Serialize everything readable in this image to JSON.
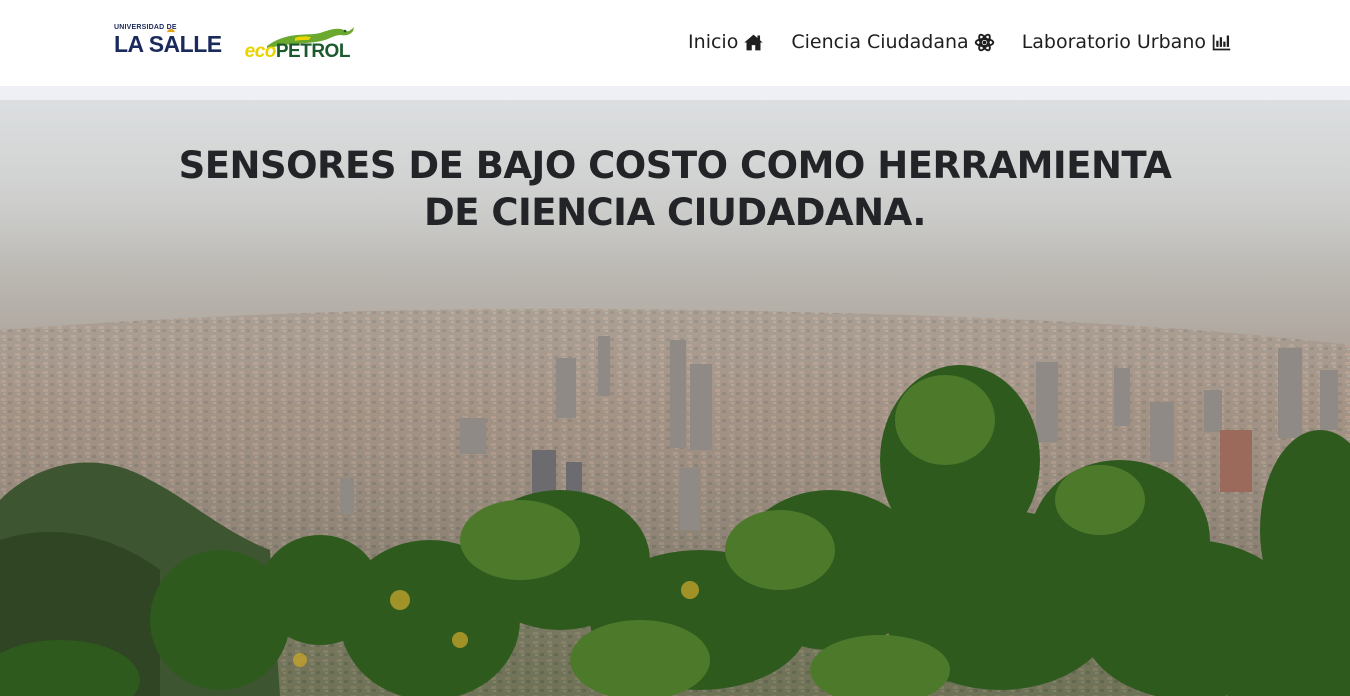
{
  "header": {
    "university_top": "UNIVERSIDAD DE",
    "university_name_part1": "LA S",
    "university_name_accent": "A",
    "university_name_part2": "LLE",
    "partner_eco": "eco",
    "partner_petrol": "PETROL",
    "nav": [
      {
        "label": "Inicio",
        "icon": "home-icon"
      },
      {
        "label": "Ciencia Ciudadana",
        "icon": "atom-icon"
      },
      {
        "label": "Laboratorio Urbano",
        "icon": "bar-chart-icon"
      }
    ]
  },
  "hero": {
    "title": "SENSORES DE BAJO COSTO COMO HERRAMIENTA DE CIENCIA CIUDADANA.",
    "image": "city-panorama-photo"
  },
  "colors": {
    "brand_navy": "#1b2a5c",
    "eco_yellow": "#e8d400",
    "eco_green": "#1c5a2e",
    "band": "#eef0f6",
    "title_text": "#222428"
  }
}
